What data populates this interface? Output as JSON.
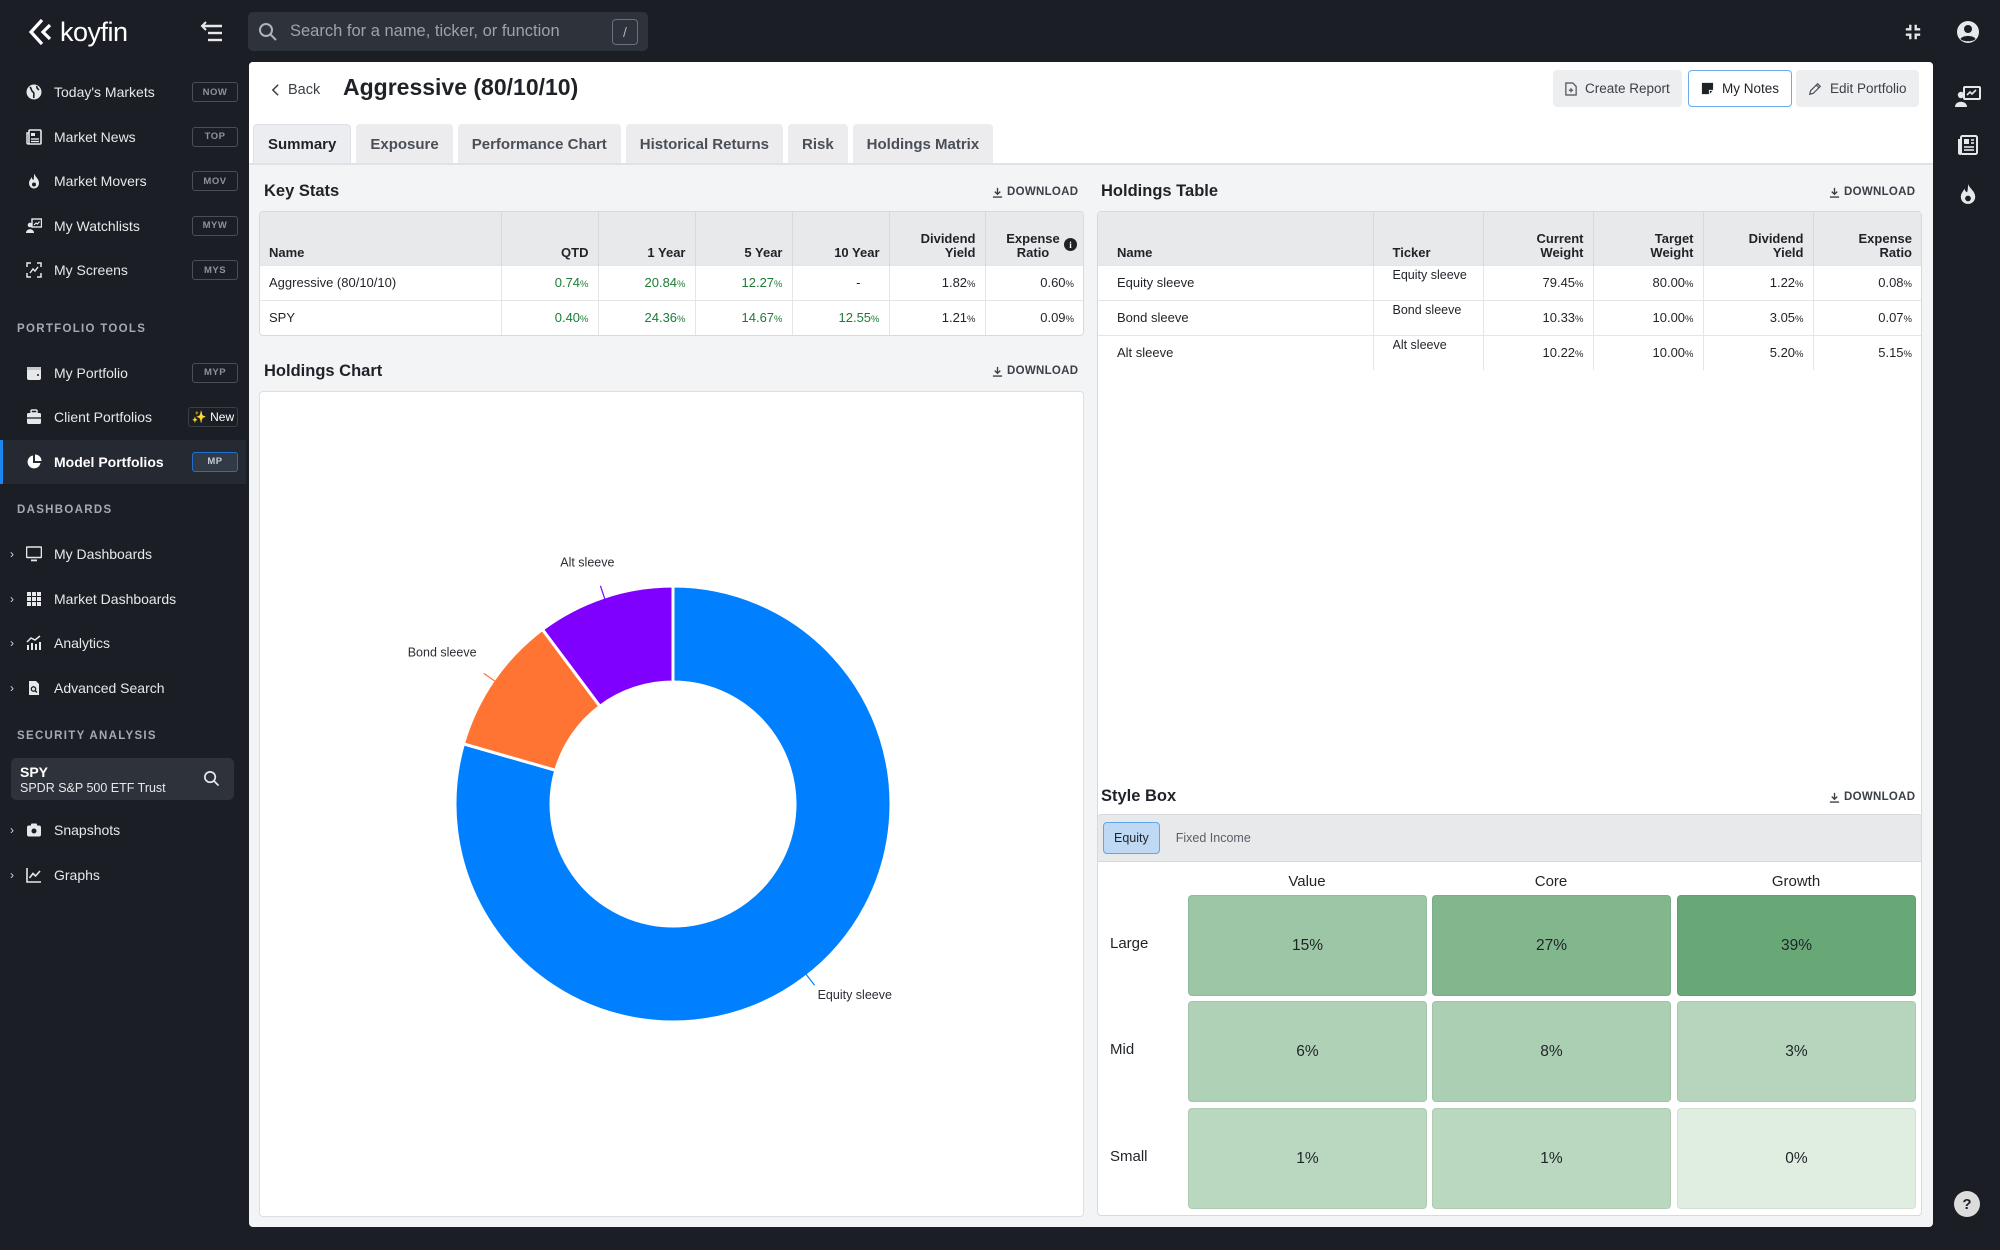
{
  "app": {
    "logo_text": "koyfin",
    "search_placeholder": "Search for a name, ticker, or function",
    "search_shortcut": "/"
  },
  "sidebar": {
    "items": [
      {
        "label": "Today's Markets",
        "badge": "NOW",
        "icon": "globe-icon"
      },
      {
        "label": "Market News",
        "badge": "TOP",
        "icon": "newspaper-icon"
      },
      {
        "label": "Market Movers",
        "badge": "MOV",
        "icon": "flame-icon"
      },
      {
        "label": "My Watchlists",
        "badge": "MYW",
        "icon": "watchlist-icon"
      },
      {
        "label": "My Screens",
        "badge": "MYS",
        "icon": "screen-icon"
      }
    ],
    "portfolio_tools_title": "PORTFOLIO TOOLS",
    "portfolio_tools": [
      {
        "label": "My Portfolio",
        "badge": "MYP",
        "icon": "wallet-icon"
      },
      {
        "label": "Client Portfolios",
        "badge": "✨ New",
        "icon": "briefcase-icon"
      },
      {
        "label": "Model Portfolios",
        "badge": "MP",
        "icon": "pie-chart-icon",
        "active": true
      }
    ],
    "dashboards_title": "DASHBOARDS",
    "dashboards": [
      {
        "label": "My Dashboards",
        "icon": "monitor-icon"
      },
      {
        "label": "Market Dashboards",
        "icon": "grid-icon"
      },
      {
        "label": "Analytics",
        "icon": "analytics-icon"
      },
      {
        "label": "Advanced Search",
        "icon": "document-search-icon"
      }
    ],
    "security_analysis_title": "SECURITY ANALYSIS",
    "security": {
      "ticker": "SPY",
      "name": "SPDR S&P 500 ETF Trust"
    },
    "security_items": [
      {
        "label": "Snapshots",
        "icon": "camera-icon"
      },
      {
        "label": "Graphs",
        "icon": "line-chart-icon"
      }
    ]
  },
  "header": {
    "back_label": "Back",
    "title": "Aggressive (80/10/10)",
    "buttons": {
      "create_report": "Create Report",
      "my_notes": "My Notes",
      "edit_portfolio": "Edit Portfolio"
    },
    "tabs": [
      "Summary",
      "Exposure",
      "Performance Chart",
      "Historical Returns",
      "Risk",
      "Holdings Matrix"
    ],
    "active_tab": "Summary"
  },
  "key_stats": {
    "title": "Key Stats",
    "download_label": "DOWNLOAD",
    "columns": [
      "Name",
      "QTD",
      "1 Year",
      "5 Year",
      "10 Year",
      "Dividend Yield",
      "Expense Ratio"
    ],
    "rows": [
      {
        "name": "Aggressive (80/10/10)",
        "qtd": "0.74",
        "y1": "20.84",
        "y5": "12.27",
        "y10": "-",
        "div": "1.82",
        "exp": "0.60"
      },
      {
        "name": "SPY",
        "qtd": "0.40",
        "y1": "24.36",
        "y5": "14.67",
        "y10": "12.55",
        "div": "1.21",
        "exp": "0.09"
      }
    ],
    "pct_symbol": "%"
  },
  "holdings_chart": {
    "title": "Holdings Chart",
    "download_label": "DOWNLOAD"
  },
  "chart_data": {
    "type": "pie",
    "title": "Holdings Chart",
    "donut": true,
    "categories": [
      "Equity sleeve",
      "Bond sleeve",
      "Alt sleeve"
    ],
    "values": [
      79.45,
      10.33,
      10.22
    ],
    "colors": [
      "#0080ff",
      "#ff7433",
      "#8000ff"
    ],
    "labels_shown": true,
    "legend": "none"
  },
  "holdings_table": {
    "title": "Holdings Table",
    "download_label": "DOWNLOAD",
    "columns": [
      "Name",
      "Ticker",
      "Current Weight",
      "Target Weight",
      "Dividend Yield",
      "Expense Ratio"
    ],
    "rows": [
      {
        "name": "Equity sleeve",
        "ticker": "Equity sleeve",
        "current": "79.45",
        "target": "80.00",
        "div": "1.22",
        "exp": "0.08"
      },
      {
        "name": "Bond sleeve",
        "ticker": "Bond sleeve",
        "current": "10.33",
        "target": "10.00",
        "div": "3.05",
        "exp": "0.07"
      },
      {
        "name": "Alt sleeve",
        "ticker": "Alt sleeve",
        "current": "10.22",
        "target": "10.00",
        "div": "5.20",
        "exp": "5.15"
      }
    ]
  },
  "style_box": {
    "title": "Style Box",
    "download_label": "DOWNLOAD",
    "tabs": [
      "Equity",
      "Fixed Income"
    ],
    "active_tab": "Equity",
    "columns": [
      "Value",
      "Core",
      "Growth"
    ],
    "rows": [
      "Large",
      "Mid",
      "Small"
    ],
    "cells": [
      [
        "15%",
        "27%",
        "39%"
      ],
      [
        "6%",
        "8%",
        "3%"
      ],
      [
        "1%",
        "1%",
        "0%"
      ]
    ],
    "cell_values": [
      [
        15,
        27,
        39
      ],
      [
        6,
        8,
        3
      ],
      [
        1,
        1,
        0
      ]
    ]
  }
}
